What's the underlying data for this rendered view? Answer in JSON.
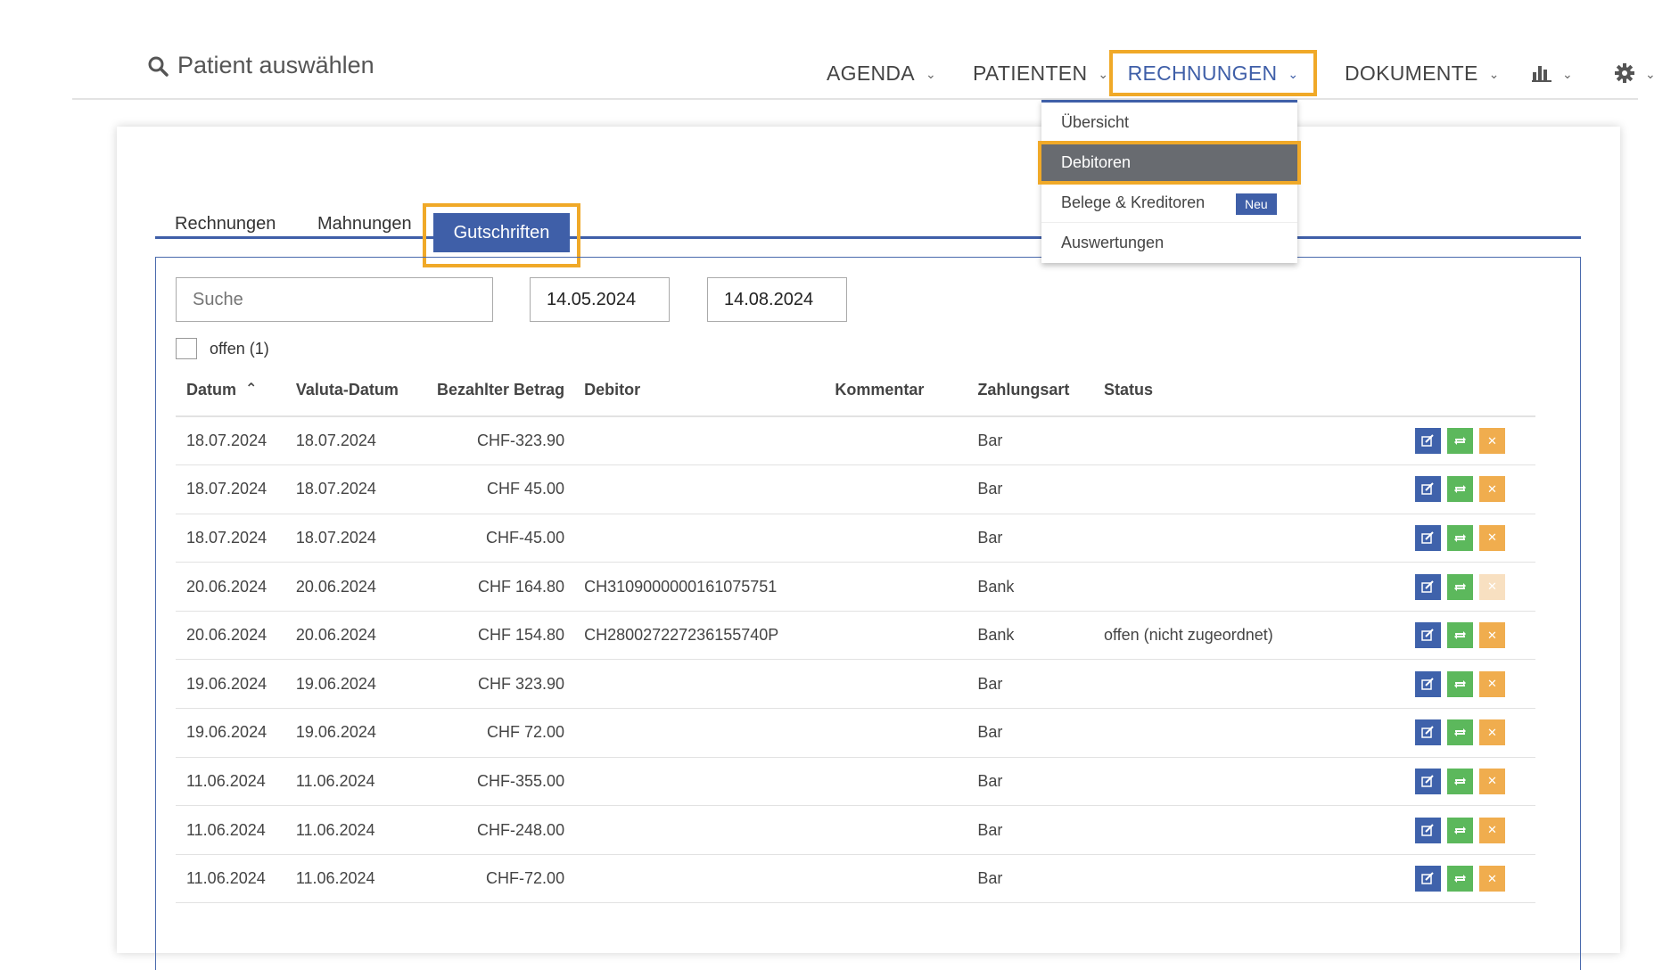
{
  "header": {
    "patient_search_label": "Patient auswählen",
    "nav": {
      "agenda": "AGENDA",
      "patienten": "PATIENTEN",
      "rechnungen": "RECHNUNGEN",
      "dokumente": "DOKUMENTE"
    },
    "icons": [
      "search-icon",
      "bar-chart-icon",
      "gear-icon",
      "chevron-down-icon"
    ]
  },
  "dropdown": {
    "items": [
      "Übersicht",
      "Debitoren",
      "Belege & Kreditoren",
      "Auswertungen"
    ],
    "badge": "Neu"
  },
  "tabs": {
    "rechnungen": "Rechnungen",
    "mahnungen": "Mahnungen",
    "gutschriften": "Gutschriften"
  },
  "filters": {
    "search_placeholder": "Suche",
    "date_from": "14.05.2024",
    "date_to": "14.08.2024",
    "open_label": "offen (1)"
  },
  "table": {
    "columns": [
      "Datum",
      "Valuta-Datum",
      "Bezahlter Betrag",
      "Debitor",
      "Kommentar",
      "Zahlungsart",
      "Status"
    ],
    "rows": [
      {
        "datum": "18.07.2024",
        "valuta": "18.07.2024",
        "betrag": "CHF-323.90",
        "debitor": "",
        "kommentar": "",
        "zahlungsart": "Bar",
        "status": ""
      },
      {
        "datum": "18.07.2024",
        "valuta": "18.07.2024",
        "betrag": "CHF 45.00",
        "debitor": "",
        "kommentar": "",
        "zahlungsart": "Bar",
        "status": ""
      },
      {
        "datum": "18.07.2024",
        "valuta": "18.07.2024",
        "betrag": "CHF-45.00",
        "debitor": "",
        "kommentar": "",
        "zahlungsart": "Bar",
        "status": ""
      },
      {
        "datum": "20.06.2024",
        "valuta": "20.06.2024",
        "betrag": "CHF 164.80",
        "debitor": "CH3109000000161075751",
        "kommentar": "",
        "zahlungsart": "Bank",
        "status": ""
      },
      {
        "datum": "20.06.2024",
        "valuta": "20.06.2024",
        "betrag": "CHF 154.80",
        "debitor": "CH280027227236155740P",
        "kommentar": "",
        "zahlungsart": "Bank",
        "status": "offen (nicht zugeordnet)"
      },
      {
        "datum": "19.06.2024",
        "valuta": "19.06.2024",
        "betrag": "CHF 323.90",
        "debitor": "",
        "kommentar": "",
        "zahlungsart": "Bar",
        "status": ""
      },
      {
        "datum": "19.06.2024",
        "valuta": "19.06.2024",
        "betrag": "CHF 72.00",
        "debitor": "",
        "kommentar": "",
        "zahlungsart": "Bar",
        "status": ""
      },
      {
        "datum": "11.06.2024",
        "valuta": "11.06.2024",
        "betrag": "CHF-355.00",
        "debitor": "",
        "kommentar": "",
        "zahlungsart": "Bar",
        "status": ""
      },
      {
        "datum": "11.06.2024",
        "valuta": "11.06.2024",
        "betrag": "CHF-248.00",
        "debitor": "",
        "kommentar": "",
        "zahlungsart": "Bar",
        "status": ""
      },
      {
        "datum": "11.06.2024",
        "valuta": "11.06.2024",
        "betrag": "CHF-72.00",
        "debitor": "",
        "kommentar": "",
        "zahlungsart": "Bar",
        "status": ""
      }
    ],
    "row_action_icons": [
      "edit-icon",
      "repeat-icon",
      "delete-icon"
    ]
  },
  "colors": {
    "primary": "#3f5fa8",
    "highlight": "#f0a928",
    "success": "#5cb85c",
    "warning": "#f0ad4e",
    "menu_active": "#686b70"
  }
}
